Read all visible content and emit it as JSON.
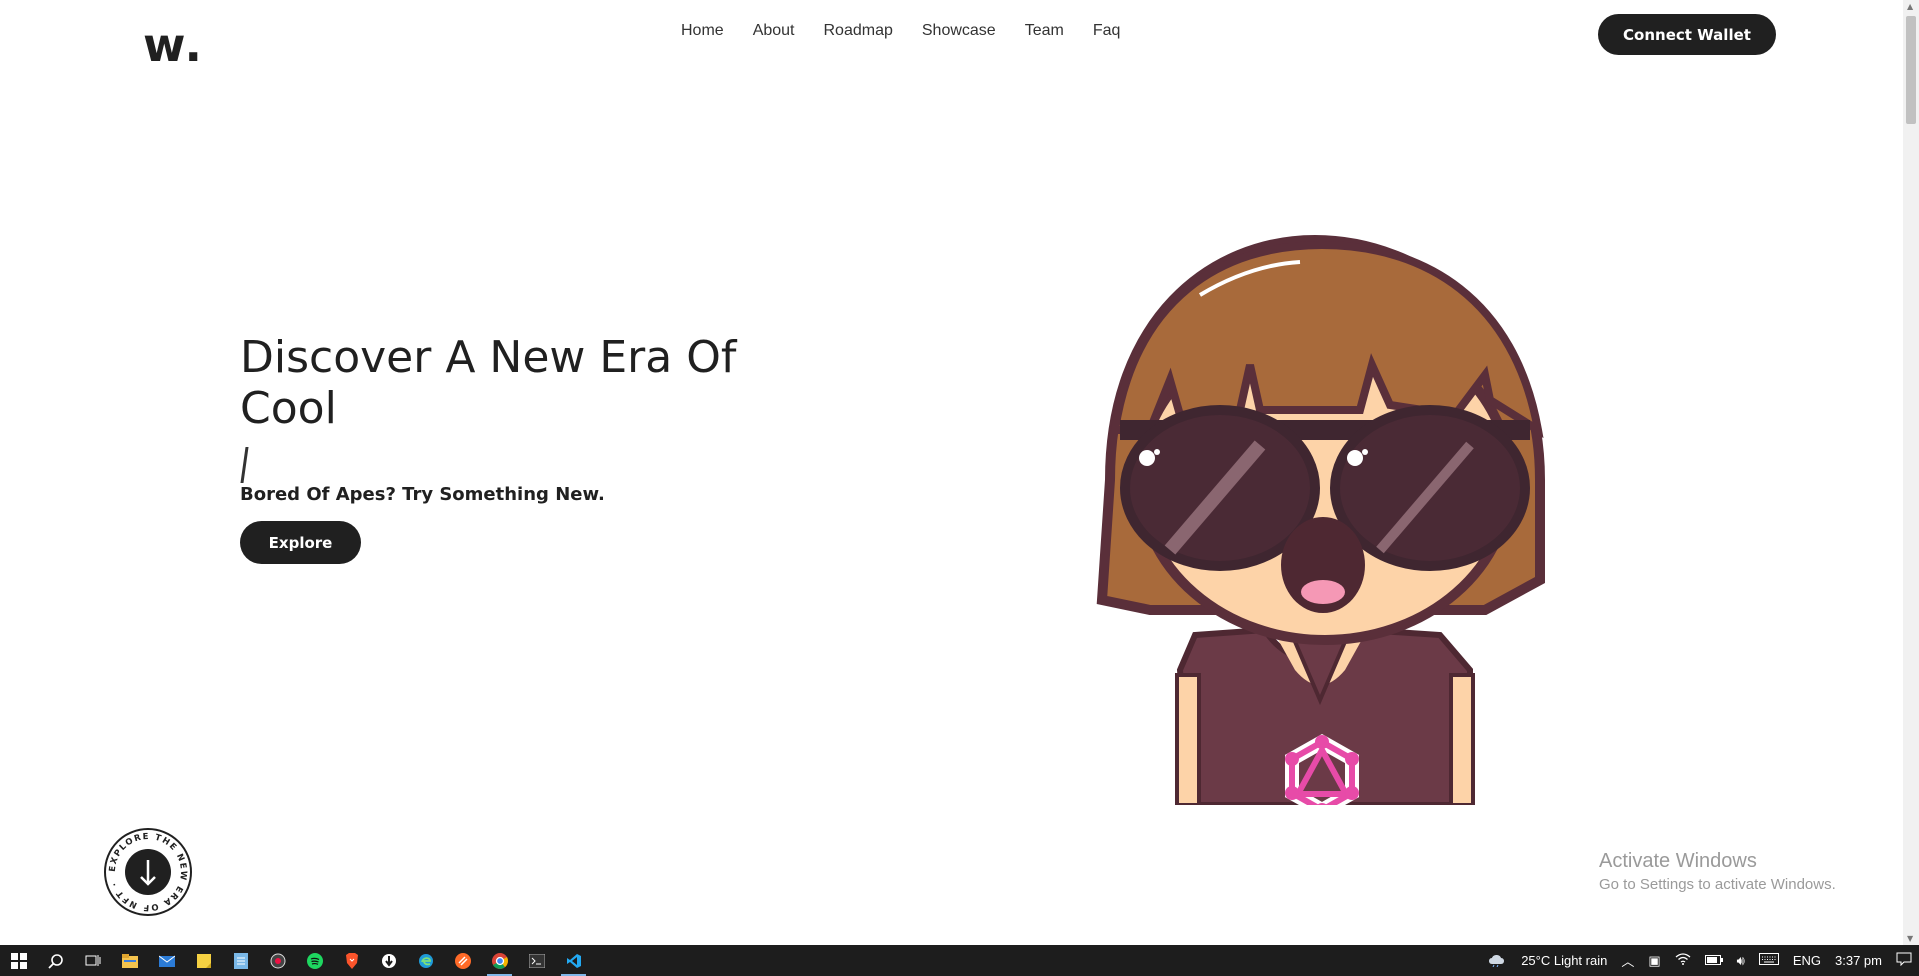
{
  "header": {
    "logo": "w.",
    "nav": [
      "Home",
      "About",
      "Roadmap",
      "Showcase",
      "Team",
      "Faq"
    ],
    "connect_label": "Connect Wallet"
  },
  "hero": {
    "title": "Discover A New Era Of Cool",
    "subtitle": "Bored Of Apes? Try Something New.",
    "explore_label": "Explore"
  },
  "badge": {
    "circle_text": "EXPLORE THE NEW ERA OF NFT ·"
  },
  "watermark": {
    "line1": "Activate Windows",
    "line2": "Go to Settings to activate Windows."
  },
  "taskbar": {
    "apps": [
      "windows-start-icon",
      "search-icon",
      "task-view-icon",
      "file-explorer-icon",
      "mail-icon",
      "sticky-notes-icon",
      "notepad-icon",
      "media-player-icon",
      "spotify-icon",
      "brave-icon",
      "torrent-icon",
      "edge-icon",
      "sublime-icon",
      "chrome-icon",
      "terminal-icon",
      "vscode-icon"
    ],
    "weather": "25°C  Light rain",
    "language": "ENG",
    "time": "3:37 pm"
  },
  "colors": {
    "primary": "#202020",
    "hair": "#a86a3b",
    "outline": "#5a2f3a",
    "skin": "#fdd3a8",
    "shirt": "#6b3a47",
    "accent_pink": "#e74ba8"
  }
}
